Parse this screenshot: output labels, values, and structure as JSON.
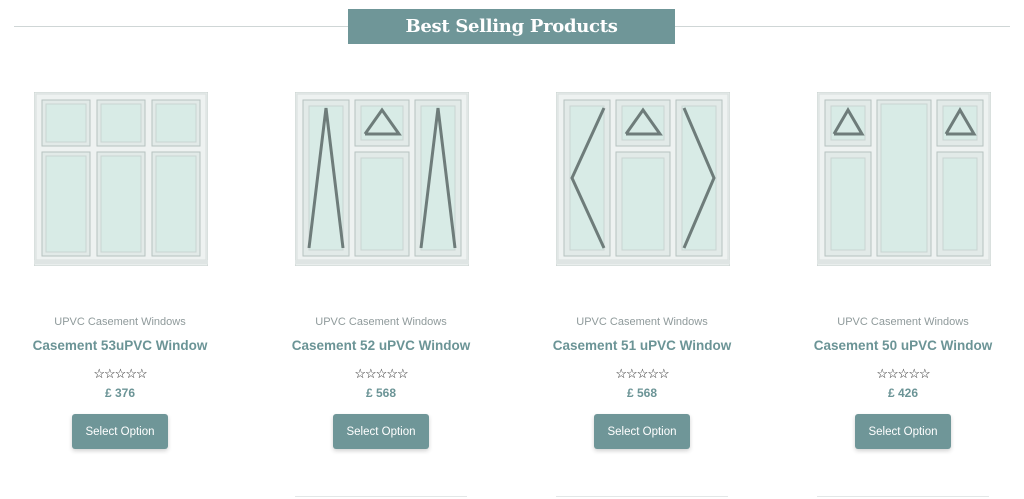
{
  "section": {
    "heading": "Best Selling Products"
  },
  "colors": {
    "accent": "#6f9698",
    "accent_text": "#6b9496",
    "frame": "#e8eeec",
    "glass": "#d7ebe6"
  },
  "products": [
    {
      "category": "UPVC Casement Windows",
      "title": "Casement 53uPVC Window",
      "rating_stars": "☆☆☆☆☆",
      "price": "£ 376",
      "button": "Select Option",
      "image_icon": "window-casement-53-icon"
    },
    {
      "category": "UPVC Casement Windows",
      "title": "Casement 52 uPVC Window",
      "rating_stars": "☆☆☆☆☆",
      "price": "£ 568",
      "button": "Select Option",
      "image_icon": "window-casement-52-icon"
    },
    {
      "category": "UPVC Casement Windows",
      "title": "Casement 51 uPVC Window",
      "rating_stars": "☆☆☆☆☆",
      "price": "£ 568",
      "button": "Select Option",
      "image_icon": "window-casement-51-icon"
    },
    {
      "category": "UPVC Casement Windows",
      "title": "Casement 50 uPVC Window",
      "rating_stars": "☆☆☆☆☆",
      "price": "£ 426",
      "button": "Select Option",
      "image_icon": "window-casement-50-icon"
    }
  ]
}
